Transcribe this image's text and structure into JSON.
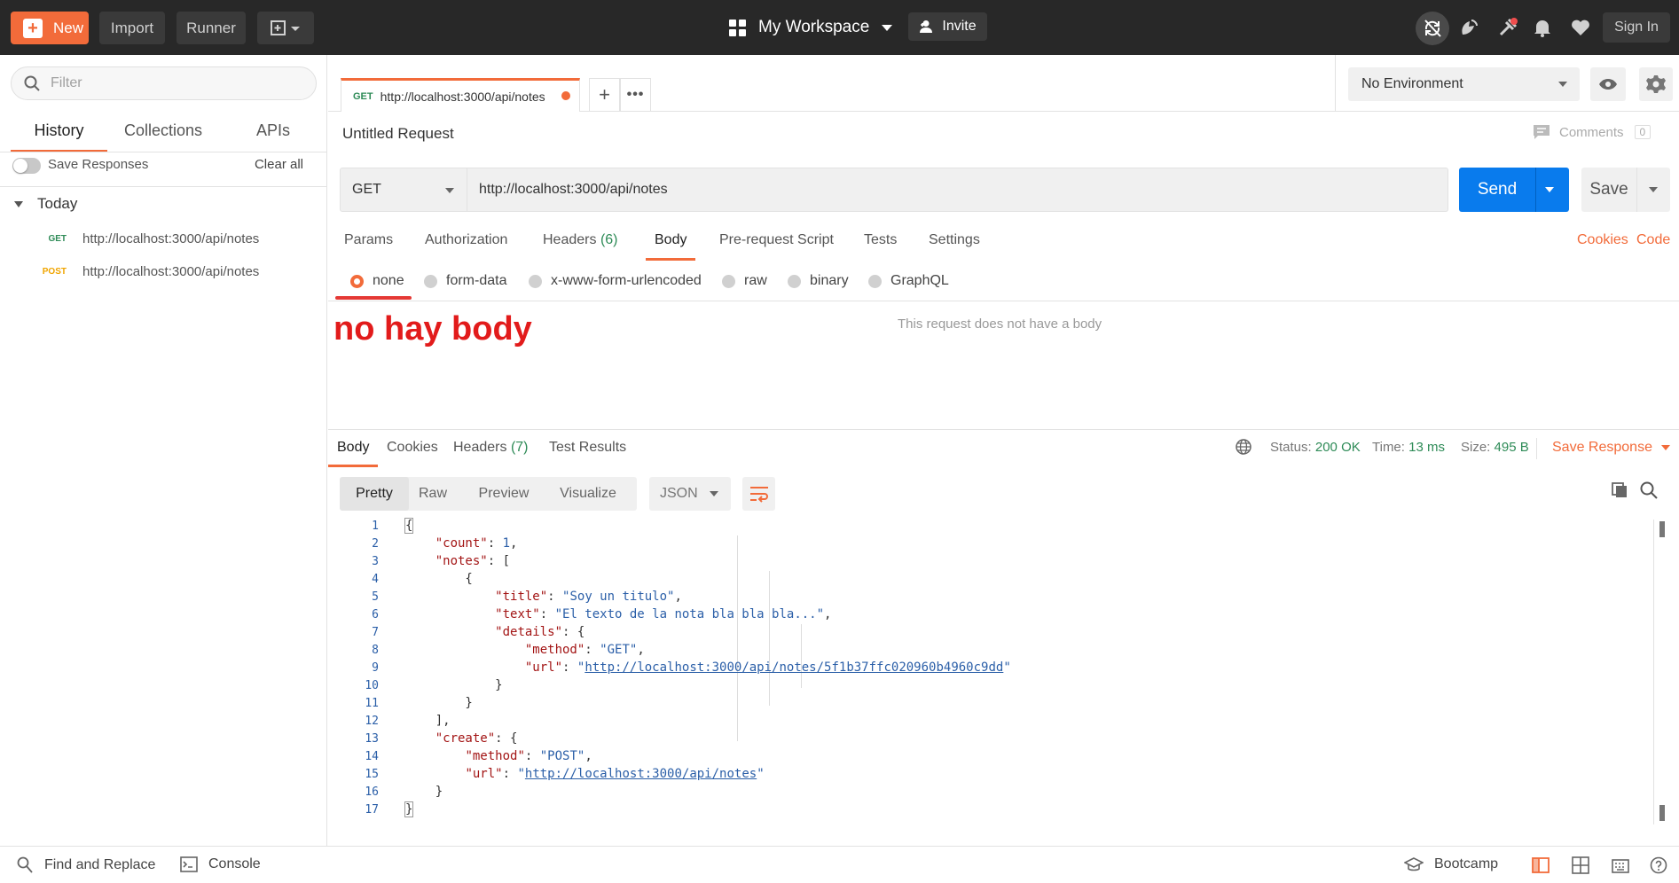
{
  "topbar": {
    "new_label": "New",
    "import_label": "Import",
    "runner_label": "Runner",
    "workspace_label": "My Workspace",
    "invite_label": "Invite",
    "signin_label": "Sign In",
    "brand_color": "#f26b3a"
  },
  "sidebar": {
    "filter_placeholder": "Filter",
    "tabs": [
      {
        "label": "History"
      },
      {
        "label": "Collections"
      },
      {
        "label": "APIs"
      }
    ],
    "save_responses_label": "Save Responses",
    "clear_all_label": "Clear all",
    "group_label": "Today",
    "history": [
      {
        "method": "GET",
        "method_color": "#2e8b57",
        "url": "http://localhost:3000/api/notes"
      },
      {
        "method": "POST",
        "method_color": "#f0a500",
        "url": "http://localhost:3000/api/notes"
      }
    ]
  },
  "request_tab": {
    "method": "GET",
    "url": "http://localhost:3000/api/notes"
  },
  "environment": {
    "selected": "No Environment"
  },
  "request": {
    "title": "Untitled Request",
    "comments_label": "Comments",
    "comments_count": "0",
    "method": "GET",
    "url": "http://localhost:3000/api/notes",
    "send_label": "Send",
    "save_label": "Save",
    "tabs": {
      "params": "Params",
      "authorization": "Authorization",
      "headers": "Headers",
      "headers_count": "(6)",
      "body": "Body",
      "prerequest": "Pre-request Script",
      "tests": "Tests",
      "settings": "Settings"
    },
    "cookies_link": "Cookies",
    "code_link": "Code",
    "body_types": [
      "none",
      "form-data",
      "x-www-form-urlencoded",
      "raw",
      "binary",
      "GraphQL"
    ],
    "annotation": "no hay body",
    "no_body_message": "This request does not have a body"
  },
  "response": {
    "tabs": {
      "body": "Body",
      "cookies": "Cookies",
      "headers": "Headers",
      "headers_count": "(7)",
      "test_results": "Test Results"
    },
    "status_label": "Status:",
    "status_value": "200 OK",
    "time_label": "Time:",
    "time_value": "13 ms",
    "size_label": "Size:",
    "size_value": "495 B",
    "save_response_label": "Save Response",
    "views": [
      "Pretty",
      "Raw",
      "Preview",
      "Visualize"
    ],
    "format": "JSON",
    "json": {
      "count_key": "\"count\"",
      "count_val": "1",
      "notes_key": "\"notes\"",
      "title_key": "\"title\"",
      "title_val": "\"Soy un titulo\"",
      "text_key": "\"text\"",
      "text_val": "\"El texto de la nota bla bla bla...\"",
      "details_key": "\"details\"",
      "method_key": "\"method\"",
      "method_val_get": "\"GET\"",
      "url_key": "\"url\"",
      "url_val_note": "http://localhost:3000/api/notes/5f1b37ffc020960b4960c9dd",
      "create_key": "\"create\"",
      "method_val_post": "\"POST\"",
      "url_val_create": "http://localhost:3000/api/notes"
    }
  },
  "statusbar": {
    "find_replace": "Find and Replace",
    "console": "Console",
    "bootcamp": "Bootcamp"
  }
}
